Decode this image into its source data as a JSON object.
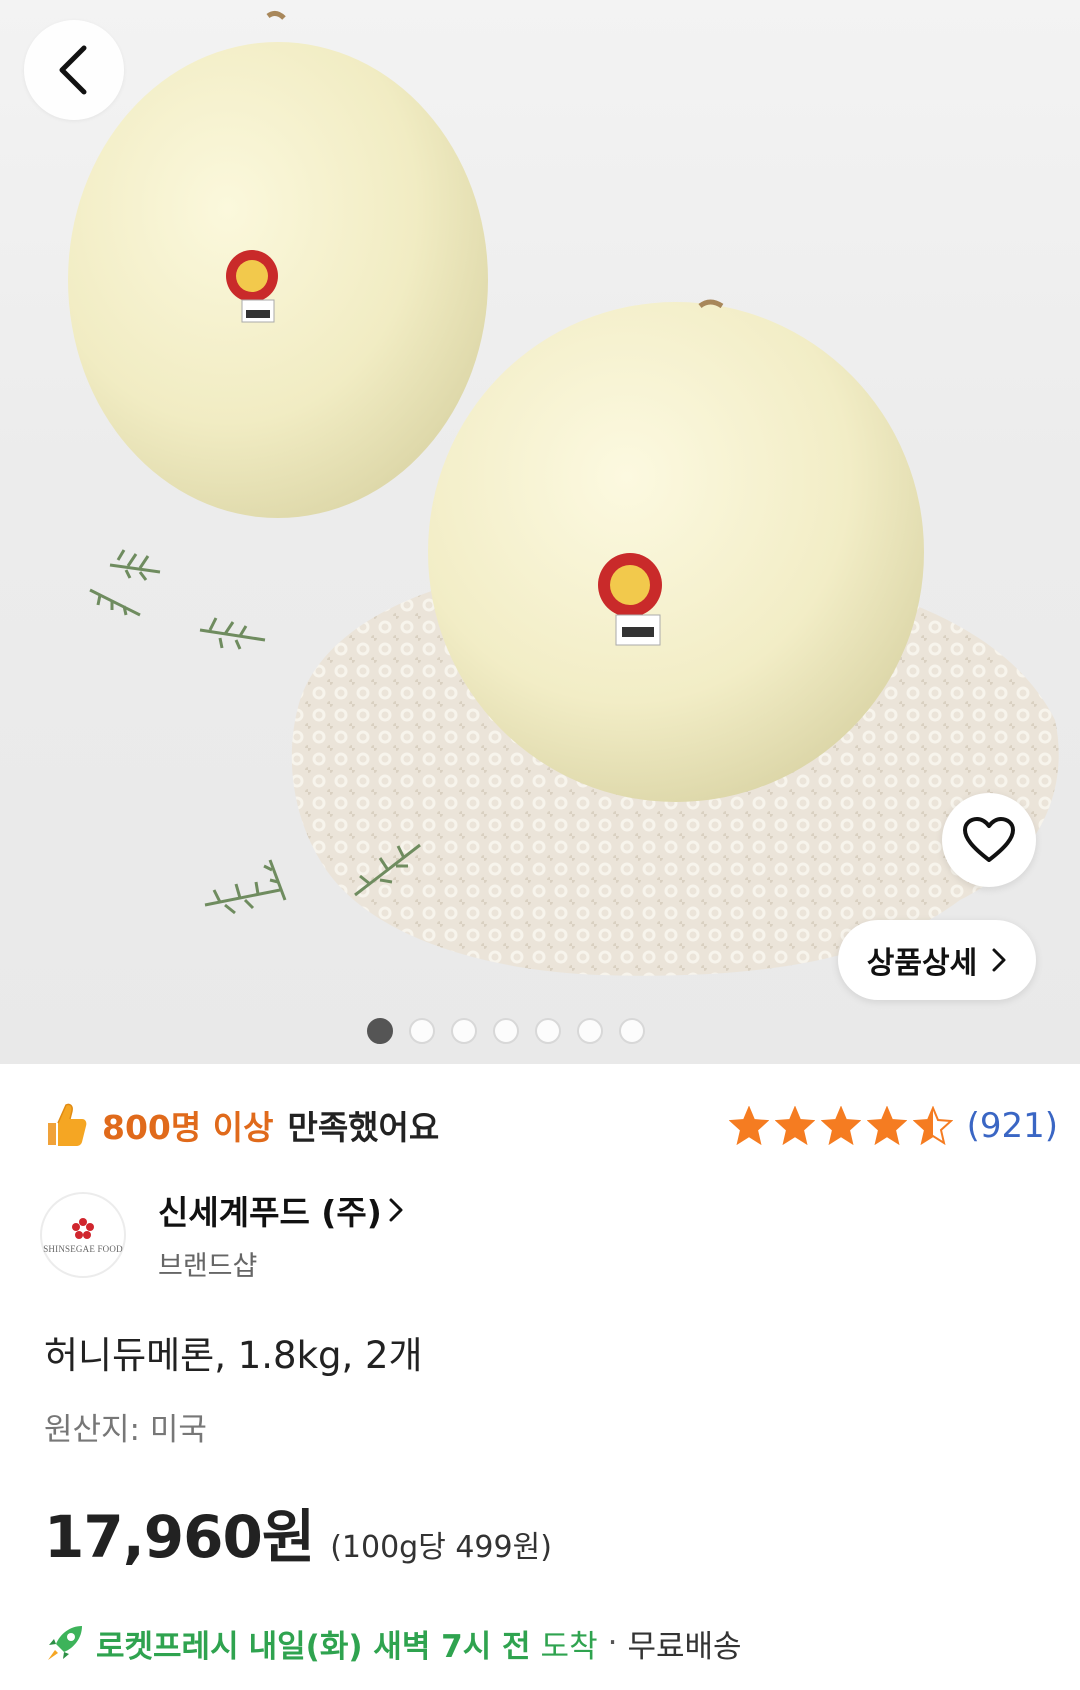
{
  "hero": {
    "image_alt": "",
    "detail_button_label": "상품상세",
    "carousel": {
      "count": 7,
      "active": 1
    }
  },
  "satisfaction": {
    "highlight": "800명 이상",
    "rest": "만족했어요"
  },
  "rating": {
    "stars": 4.5,
    "count_label": "(921)"
  },
  "seller": {
    "name": "신세계푸드 (주)",
    "subtitle": "브랜드샵",
    "logo_text": "SHINSEGAE FOOD"
  },
  "product": {
    "title": "허니듀메론, 1.8kg, 2개",
    "origin": "원산지: 미국",
    "price": "17,960원",
    "unit_price": "(100g당 499원)"
  },
  "delivery": {
    "brand": "로켓프레시",
    "arrival_bold": "내일(화) 새벽 7시 전",
    "arrival_tail": "도착",
    "separator": "·",
    "shipping": "무료배송"
  },
  "colors": {
    "accent_orange": "#e06a1b",
    "star": "#f57c21",
    "rating_blue": "#3a66c4",
    "rocket_green": "#2fa34f"
  }
}
